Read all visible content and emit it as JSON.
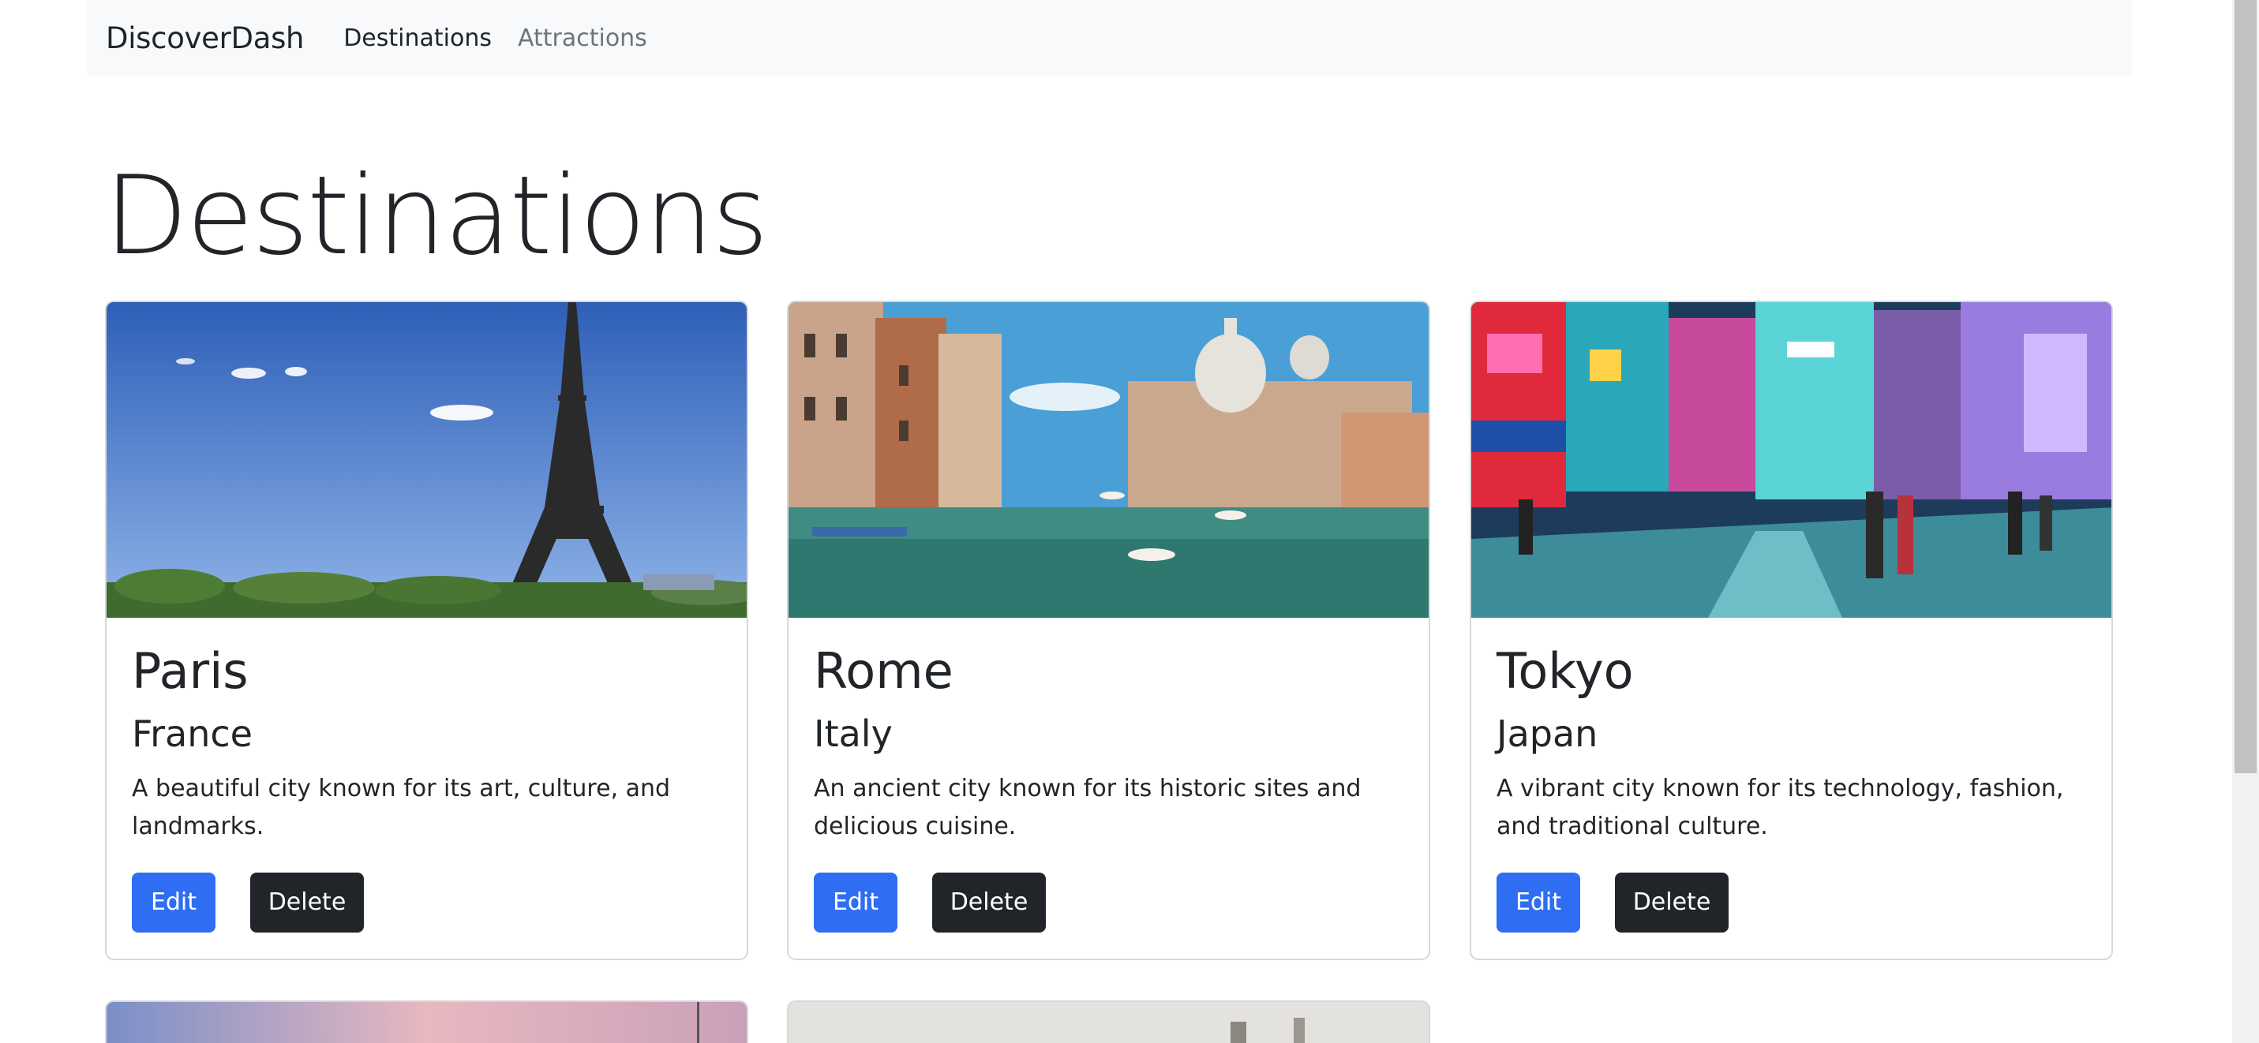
{
  "nav": {
    "brand": "DiscoverDash",
    "links": [
      "Destinations",
      "Attractions"
    ]
  },
  "page": {
    "title": "Destinations"
  },
  "cards": [
    {
      "city": "Paris",
      "country": "France",
      "description": "A beautiful city known for its art, culture, and landmarks.",
      "edit": "Edit",
      "delete": "Delete"
    },
    {
      "city": "Rome",
      "country": "Italy",
      "description": "An ancient city known for its historic sites and delicious cuisine.",
      "edit": "Edit",
      "delete": "Delete"
    },
    {
      "city": "Tokyo",
      "country": "Japan",
      "description": "A vibrant city known for its technology, fashion, and traditional culture.",
      "edit": "Edit",
      "delete": "Delete"
    }
  ],
  "colors": {
    "primary": "#2f6ef3",
    "dark": "#212529",
    "navbar_bg": "#f8f9fa"
  }
}
